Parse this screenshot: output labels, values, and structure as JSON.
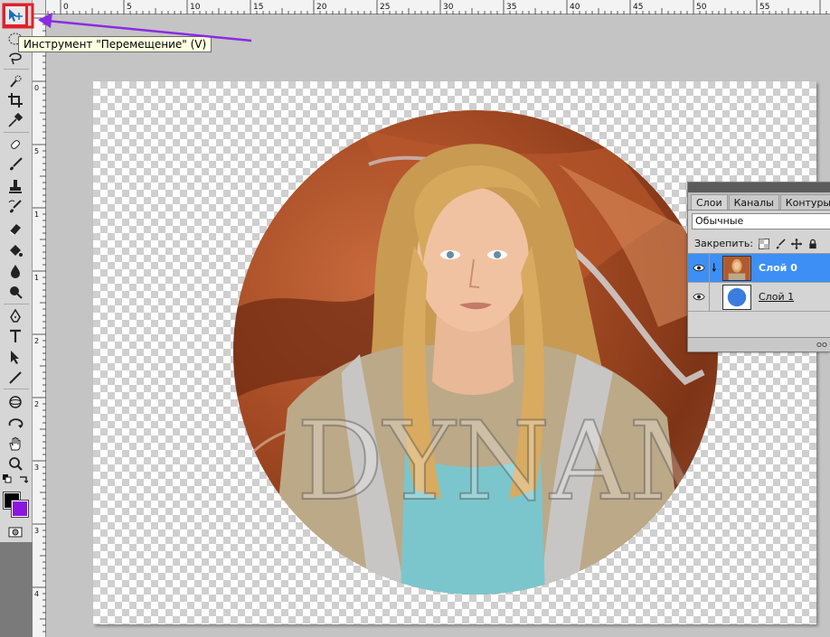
{
  "tooltip": {
    "text": "Инструмент \"Перемещение\" (V)"
  },
  "ruler_top": {
    "labels": [
      "0",
      "5",
      "10",
      "15",
      "20",
      "25",
      "30",
      "35",
      "40",
      "45",
      "50",
      "55"
    ]
  },
  "ruler_left": {
    "labels": [
      "0",
      "5",
      "1",
      "1",
      "2",
      "2",
      "3",
      "3",
      "4"
    ]
  },
  "colors": {
    "foreground": "#000000",
    "background": "#8a16e0",
    "selection": "#3d8ff5",
    "highlight": "#e0202a",
    "arrow": "#8a2be2"
  },
  "tools": [
    "move-tool-icon",
    "marquee-icon",
    "lasso-icon",
    "quick-select-icon",
    "crop-icon",
    "eyedropper-icon",
    "healing-brush-icon",
    "brush-icon",
    "clone-stamp-icon",
    "history-brush-icon",
    "eraser-icon",
    "paint-bucket-icon",
    "blur-icon",
    "dodge-icon",
    "pen-icon",
    "type-icon",
    "path-select-icon",
    "line-icon",
    "3d-rotate-icon",
    "3d-orbit-icon",
    "hand-icon",
    "zoom-icon"
  ],
  "layers_panel": {
    "tabs": [
      "Слои",
      "Каналы",
      "Контуры"
    ],
    "blend_mode": "Обычные",
    "lock_label": "Закрепить:",
    "layers": [
      {
        "name": "Слой 0",
        "selected": true
      },
      {
        "name": "Слой 1",
        "selected": false
      }
    ]
  }
}
